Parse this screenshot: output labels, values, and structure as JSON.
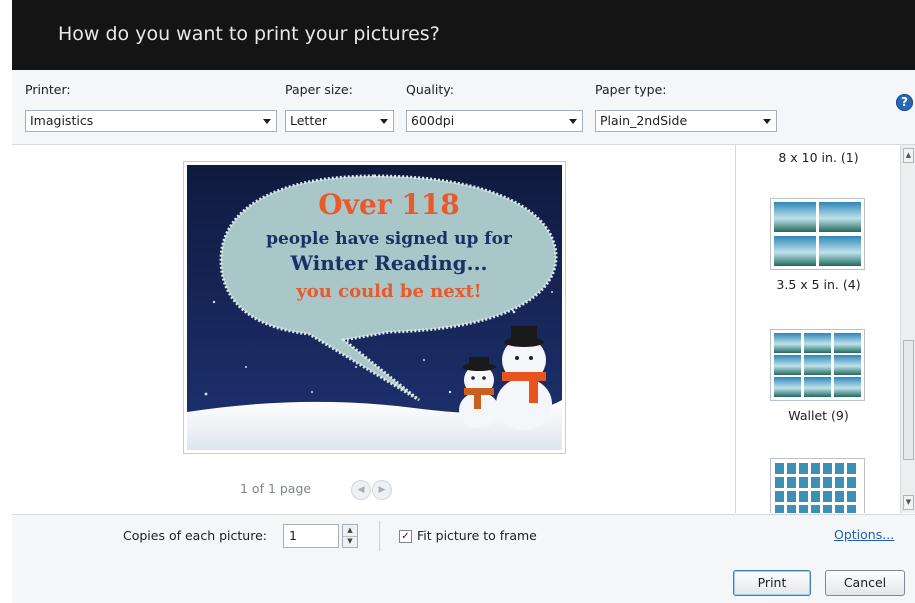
{
  "dialog": {
    "title": "How do you want to print your pictures?"
  },
  "options": {
    "printer": {
      "label": "Printer:",
      "value": "Imagistics"
    },
    "paper_size": {
      "label": "Paper size:",
      "value": "Letter"
    },
    "quality": {
      "label": "Quality:",
      "value": "600dpi"
    },
    "paper_type": {
      "label": "Paper type:",
      "value": "Plain_2ndSide"
    },
    "help_icon": "help-icon"
  },
  "preview": {
    "image_text": {
      "line1": "Over 118",
      "line2": "people have signed up for",
      "line3": "Winter Reading...",
      "line4": "you could be next!"
    },
    "pager": "1 of 1 page",
    "prev_icon": "prev-arrow-icon",
    "next_icon": "next-arrow-icon"
  },
  "layouts": [
    {
      "label": "8 x 10 in. (1)"
    },
    {
      "label": "3.5 x 5 in. (4)"
    },
    {
      "label": "Wallet (9)"
    }
  ],
  "bottom": {
    "copies_label": "Copies of each picture:",
    "copies_value": "1",
    "fit_label": "Fit picture to frame",
    "fit_checked": true,
    "options_link": "Options...",
    "print_button": "Print",
    "cancel_button": "Cancel"
  },
  "colors": {
    "title_bg": "#141414",
    "accent_link": "#1f5fb4",
    "bubble_orange": "#e85a2a",
    "bubble_navy": "#1c2f66",
    "night_sky": "#14214a"
  }
}
